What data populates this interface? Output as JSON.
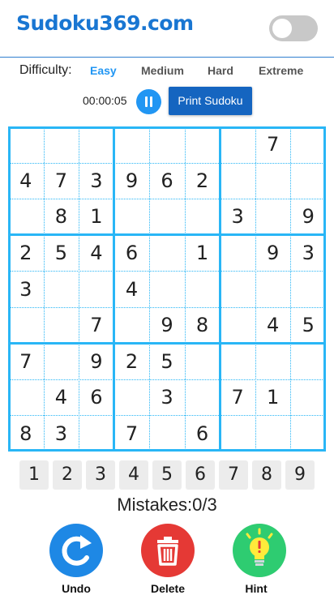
{
  "header": {
    "logo": "Sudoku369.com",
    "theme_toggle_on": false
  },
  "difficulty": {
    "label": "Difficulty:",
    "options": [
      "Easy",
      "Medium",
      "Hard",
      "Extreme"
    ],
    "selected": "Easy"
  },
  "controls": {
    "timer": "00:00:05",
    "print_label": "Print Sudoku"
  },
  "board": [
    [
      "",
      "",
      "",
      "",
      "",
      "",
      "",
      "7",
      ""
    ],
    [
      "4",
      "7",
      "3",
      "9",
      "6",
      "2",
      "",
      "",
      ""
    ],
    [
      "",
      "8",
      "1",
      "",
      "",
      "",
      "3",
      "",
      "9"
    ],
    [
      "2",
      "5",
      "4",
      "6",
      "",
      "1",
      "",
      "9",
      "3"
    ],
    [
      "3",
      "",
      "",
      "4",
      "",
      "",
      "",
      "",
      ""
    ],
    [
      "",
      "",
      "7",
      "",
      "9",
      "8",
      "",
      "4",
      "5"
    ],
    [
      "7",
      "",
      "9",
      "2",
      "5",
      "",
      "",
      "",
      ""
    ],
    [
      "",
      "4",
      "6",
      "",
      "3",
      "",
      "7",
      "1",
      ""
    ],
    [
      "8",
      "3",
      "",
      "7",
      "",
      "6",
      "",
      "",
      ""
    ]
  ],
  "numpad": [
    "1",
    "2",
    "3",
    "4",
    "5",
    "6",
    "7",
    "8",
    "9"
  ],
  "mistakes": "Mistakes:0/3",
  "actions": {
    "undo_label": "Undo",
    "delete_label": "Delete",
    "hint_label": "Hint"
  },
  "colors": {
    "brand": "#1976d2",
    "accent": "#2196f3",
    "grid": "#29b6f6",
    "undo": "#1e88e5",
    "delete": "#e53935",
    "hint": "#2ecc71"
  }
}
